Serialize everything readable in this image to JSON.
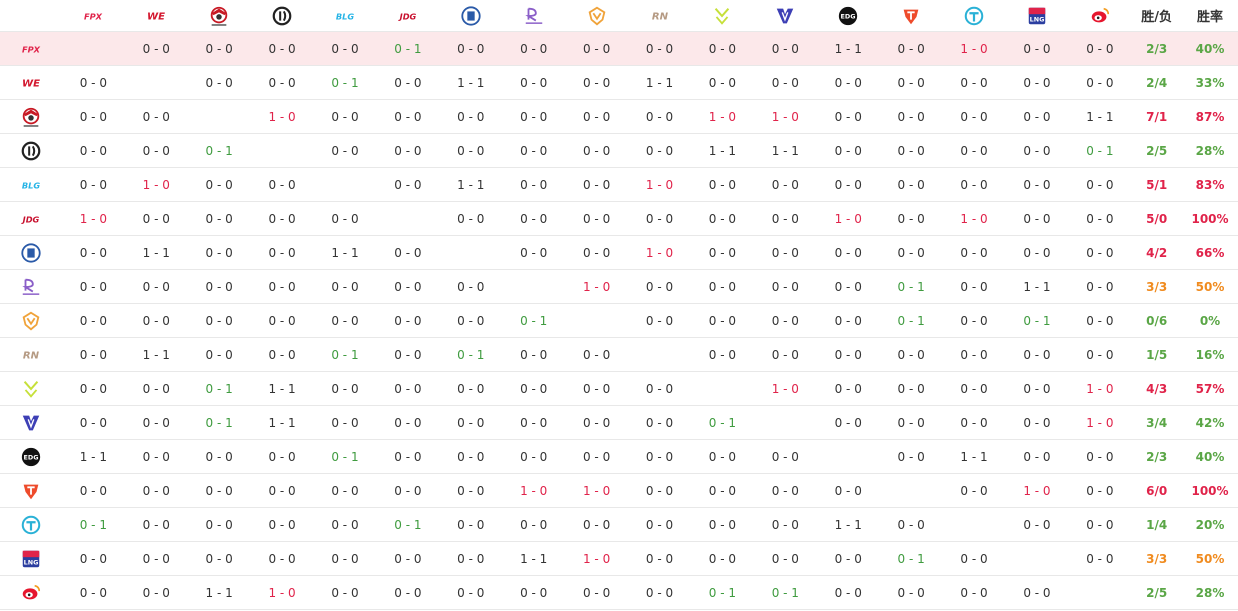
{
  "header": {
    "record_label": "胜/负",
    "rate_label": "胜率"
  },
  "colors": {
    "win": "#e0234a",
    "loss": "#3f9b3f",
    "draw": "#333333",
    "highlight": "#fce8ea",
    "good": "#5aa646",
    "mid": "#f08b1f",
    "bad": "#e0234a"
  },
  "teams": [
    {
      "logo": "fpx-logo",
      "logo_text": "FPX",
      "color": "#e0234a",
      "record": "2/3",
      "rate": "40%",
      "rate_tier": "good"
    },
    {
      "logo": "we-logo",
      "logo_text": "WE",
      "color": "#d3162d",
      "record": "2/4",
      "rate": "33%",
      "rate_tier": "good"
    },
    {
      "logo": "omg-logo",
      "logo_text": "",
      "color": "#c81a25",
      "record": "7/1",
      "rate": "87%",
      "rate_tier": "bad"
    },
    {
      "logo": "ig-logo",
      "logo_text": "",
      "color": "#222222",
      "record": "2/5",
      "rate": "28%",
      "rate_tier": "good"
    },
    {
      "logo": "blg-logo",
      "logo_text": "BLG",
      "color": "#27b4e6",
      "record": "5/1",
      "rate": "83%",
      "rate_tier": "bad"
    },
    {
      "logo": "jdg-logo",
      "logo_text": "JDG",
      "color": "#c8102e",
      "record": "5/0",
      "rate": "100%",
      "rate_tier": "bad"
    },
    {
      "logo": "lgd-logo",
      "logo_text": "LGD",
      "color": "#2a5aa8",
      "record": "4/2",
      "rate": "66%",
      "rate_tier": "bad"
    },
    {
      "logo": "rw-logo",
      "logo_text": "RW",
      "color": "#8a5ec8",
      "record": "3/3",
      "rate": "50%",
      "rate_tier": "mid"
    },
    {
      "logo": "v5-logo",
      "logo_text": "",
      "color": "#f0a33a",
      "record": "0/6",
      "rate": "0%",
      "rate_tier": "good"
    },
    {
      "logo": "rng-logo",
      "logo_text": "RN",
      "color": "#b59a83",
      "record": "1/5",
      "rate": "16%",
      "rate_tier": "good"
    },
    {
      "logo": "up-logo",
      "logo_text": "UP",
      "color": "#c6e03a",
      "record": "4/3",
      "rate": "57%",
      "rate_tier": "bad"
    },
    {
      "logo": "vg-logo",
      "logo_text": "",
      "color": "#3d3fb5",
      "record": "3/4",
      "rate": "42%",
      "rate_tier": "good"
    },
    {
      "logo": "edg-logo",
      "logo_text": "EDG",
      "color": "#111111",
      "record": "2/3",
      "rate": "40%",
      "rate_tier": "good"
    },
    {
      "logo": "tes-logo",
      "logo_text": "",
      "color": "#ee4b2b",
      "record": "6/0",
      "rate": "100%",
      "rate_tier": "bad"
    },
    {
      "logo": "tt-logo",
      "logo_text": "TT",
      "color": "#2ab1d6",
      "record": "1/4",
      "rate": "20%",
      "rate_tier": "good"
    },
    {
      "logo": "lng-logo",
      "logo_text": "LNG",
      "color": "#2b3ea0",
      "record": "3/3",
      "rate": "50%",
      "rate_tier": "mid"
    },
    {
      "logo": "weibo-logo",
      "logo_text": "",
      "color": "#e6162d",
      "record": "2/5",
      "rate": "28%",
      "rate_tier": "good"
    }
  ],
  "matrix": [
    [
      "",
      "0 - 0",
      "0 - 0",
      "0 - 0",
      "0 - 0",
      "0 - 1",
      "0 - 0",
      "0 - 0",
      "0 - 0",
      "0 - 0",
      "0 - 0",
      "0 - 0",
      "1 - 1",
      "0 - 0",
      "1 - 0",
      "0 - 0",
      "0 - 0"
    ],
    [
      "0 - 0",
      "",
      "0 - 0",
      "0 - 0",
      "0 - 1",
      "0 - 0",
      "1 - 1",
      "0 - 0",
      "0 - 0",
      "1 - 1",
      "0 - 0",
      "0 - 0",
      "0 - 0",
      "0 - 0",
      "0 - 0",
      "0 - 0",
      "0 - 0"
    ],
    [
      "0 - 0",
      "0 - 0",
      "",
      "1 - 0",
      "0 - 0",
      "0 - 0",
      "0 - 0",
      "0 - 0",
      "0 - 0",
      "0 - 0",
      "1 - 0",
      "1 - 0",
      "0 - 0",
      "0 - 0",
      "0 - 0",
      "0 - 0",
      "1 - 1"
    ],
    [
      "0 - 0",
      "0 - 0",
      "0 - 1",
      "",
      "0 - 0",
      "0 - 0",
      "0 - 0",
      "0 - 0",
      "0 - 0",
      "0 - 0",
      "1 - 1",
      "1 - 1",
      "0 - 0",
      "0 - 0",
      "0 - 0",
      "0 - 0",
      "0 - 1"
    ],
    [
      "0 - 0",
      "1 - 0",
      "0 - 0",
      "0 - 0",
      "",
      "0 - 0",
      "1 - 1",
      "0 - 0",
      "0 - 0",
      "1 - 0",
      "0 - 0",
      "0 - 0",
      "0 - 0",
      "0 - 0",
      "0 - 0",
      "0 - 0",
      "0 - 0"
    ],
    [
      "1 - 0",
      "0 - 0",
      "0 - 0",
      "0 - 0",
      "0 - 0",
      "",
      "0 - 0",
      "0 - 0",
      "0 - 0",
      "0 - 0",
      "0 - 0",
      "0 - 0",
      "1 - 0",
      "0 - 0",
      "1 - 0",
      "0 - 0",
      "0 - 0"
    ],
    [
      "0 - 0",
      "1 - 1",
      "0 - 0",
      "0 - 0",
      "1 - 1",
      "0 - 0",
      "",
      "0 - 0",
      "0 - 0",
      "1 - 0",
      "0 - 0",
      "0 - 0",
      "0 - 0",
      "0 - 0",
      "0 - 0",
      "0 - 0",
      "0 - 0"
    ],
    [
      "0 - 0",
      "0 - 0",
      "0 - 0",
      "0 - 0",
      "0 - 0",
      "0 - 0",
      "0 - 0",
      "",
      "1 - 0",
      "0 - 0",
      "0 - 0",
      "0 - 0",
      "0 - 0",
      "0 - 1",
      "0 - 0",
      "1 - 1",
      "0 - 0"
    ],
    [
      "0 - 0",
      "0 - 0",
      "0 - 0",
      "0 - 0",
      "0 - 0",
      "0 - 0",
      "0 - 0",
      "0 - 1",
      "",
      "0 - 0",
      "0 - 0",
      "0 - 0",
      "0 - 0",
      "0 - 1",
      "0 - 0",
      "0 - 1",
      "0 - 0"
    ],
    [
      "0 - 0",
      "1 - 1",
      "0 - 0",
      "0 - 0",
      "0 - 1",
      "0 - 0",
      "0 - 1",
      "0 - 0",
      "0 - 0",
      "",
      "0 - 0",
      "0 - 0",
      "0 - 0",
      "0 - 0",
      "0 - 0",
      "0 - 0",
      "0 - 0"
    ],
    [
      "0 - 0",
      "0 - 0",
      "0 - 1",
      "1 - 1",
      "0 - 0",
      "0 - 0",
      "0 - 0",
      "0 - 0",
      "0 - 0",
      "0 - 0",
      "",
      "1 - 0",
      "0 - 0",
      "0 - 0",
      "0 - 0",
      "0 - 0",
      "1 - 0"
    ],
    [
      "0 - 0",
      "0 - 0",
      "0 - 1",
      "1 - 1",
      "0 - 0",
      "0 - 0",
      "0 - 0",
      "0 - 0",
      "0 - 0",
      "0 - 0",
      "0 - 1",
      "",
      "0 - 0",
      "0 - 0",
      "0 - 0",
      "0 - 0",
      "1 - 0"
    ],
    [
      "1 - 1",
      "0 - 0",
      "0 - 0",
      "0 - 0",
      "0 - 1",
      "0 - 0",
      "0 - 0",
      "0 - 0",
      "0 - 0",
      "0 - 0",
      "0 - 0",
      "0 - 0",
      "",
      "0 - 0",
      "1 - 1",
      "0 - 0",
      "0 - 0"
    ],
    [
      "0 - 0",
      "0 - 0",
      "0 - 0",
      "0 - 0",
      "0 - 0",
      "0 - 0",
      "0 - 0",
      "1 - 0",
      "1 - 0",
      "0 - 0",
      "0 - 0",
      "0 - 0",
      "0 - 0",
      "",
      "0 - 0",
      "1 - 0",
      "0 - 0"
    ],
    [
      "0 - 1",
      "0 - 0",
      "0 - 0",
      "0 - 0",
      "0 - 0",
      "0 - 1",
      "0 - 0",
      "0 - 0",
      "0 - 0",
      "0 - 0",
      "0 - 0",
      "0 - 0",
      "1 - 1",
      "0 - 0",
      "",
      "0 - 0",
      "0 - 0"
    ],
    [
      "0 - 0",
      "0 - 0",
      "0 - 0",
      "0 - 0",
      "0 - 0",
      "0 - 0",
      "0 - 0",
      "1 - 1",
      "1 - 0",
      "0 - 0",
      "0 - 0",
      "0 - 0",
      "0 - 0",
      "0 - 1",
      "0 - 0",
      "",
      "0 - 0"
    ],
    [
      "0 - 0",
      "0 - 0",
      "1 - 1",
      "1 - 0",
      "0 - 0",
      "0 - 0",
      "0 - 0",
      "0 - 0",
      "0 - 0",
      "0 - 0",
      "0 - 1",
      "0 - 1",
      "0 - 0",
      "0 - 0",
      "0 - 0",
      "0 - 0",
      ""
    ]
  ]
}
